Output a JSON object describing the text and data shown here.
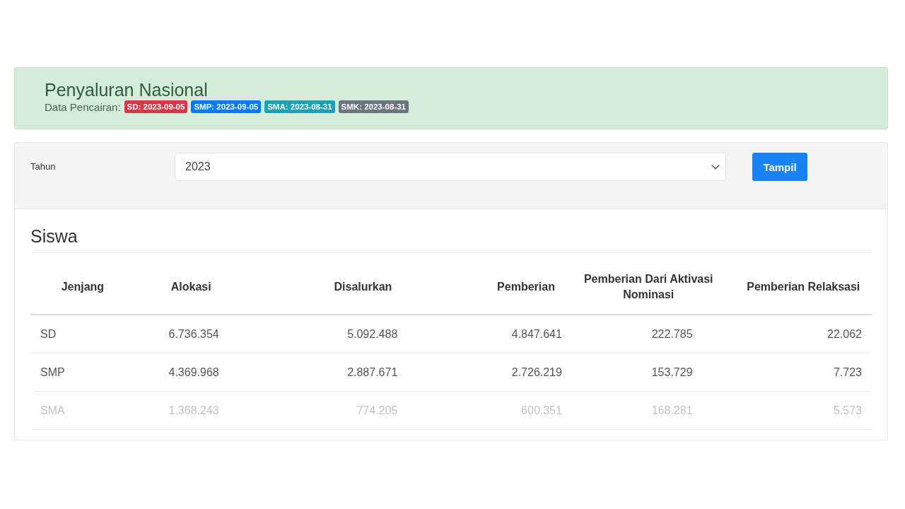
{
  "banner": {
    "title": "Penyaluran Nasional",
    "label": "Data Pencairan:",
    "badges": [
      {
        "text": "SD: 2023-09-05",
        "color": "#dc3545"
      },
      {
        "text": "SMP: 2023-09-05",
        "color": "#007bff"
      },
      {
        "text": "SMA: 2023-08-31",
        "color": "#17a2b8"
      },
      {
        "text": "SMK: 2023-08-31",
        "color": "#6c757d"
      }
    ]
  },
  "filter": {
    "label": "Tahun",
    "value": "2023",
    "button": "Tampil"
  },
  "section": {
    "title": "Siswa"
  },
  "table": {
    "columns": [
      "Jenjang",
      "Alokasi",
      "Disalurkan",
      "Pemberian",
      "Pemberian Dari Aktivasi Nominasi",
      "Pemberian Relaksasi"
    ],
    "rows": [
      [
        "SD",
        "6.736.354",
        "5.092.488",
        "4.847.641",
        "222.785",
        "22.062"
      ],
      [
        "SMP",
        "4.369.968",
        "2.887.671",
        "2.726.219",
        "153.729",
        "7.723"
      ],
      [
        "SMA",
        "1.368.243",
        "774.205",
        "600.351",
        "168.281",
        "5.573"
      ]
    ]
  }
}
